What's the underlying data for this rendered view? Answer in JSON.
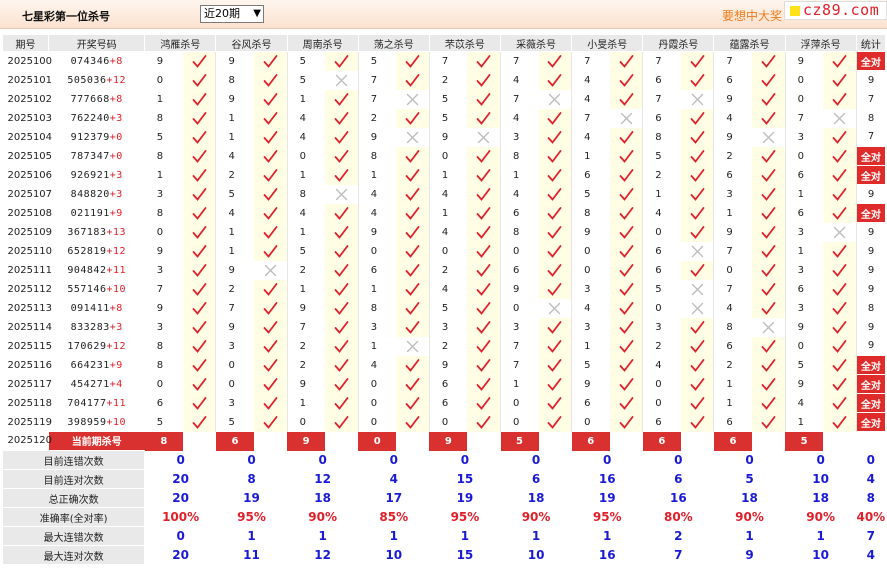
{
  "header": {
    "title": "七星彩第一位杀号",
    "period_select": "近20期",
    "banner": "要想中大奖",
    "site": "cz89.com"
  },
  "columns": [
    "期号",
    "开奖号码",
    "鸿雁杀号",
    "谷风杀号",
    "周南杀号",
    "荡之杀号",
    "芣苡杀号",
    "采薇杀号",
    "小旻杀号",
    "丹霞杀号",
    "蕴露杀号",
    "浮萍杀号",
    "统计"
  ],
  "rows": [
    {
      "period": "2025100",
      "draw": "074346",
      "plus": "+8",
      "kills": [
        9,
        9,
        5,
        5,
        7,
        7,
        7,
        7,
        7,
        9
      ],
      "ok": [
        1,
        1,
        1,
        1,
        1,
        1,
        1,
        1,
        1,
        1
      ],
      "stat": "全对"
    },
    {
      "period": "2025101",
      "draw": "505036",
      "plus": "+12",
      "kills": [
        0,
        8,
        5,
        7,
        2,
        4,
        4,
        6,
        6,
        0
      ],
      "ok": [
        1,
        1,
        0,
        1,
        1,
        1,
        1,
        1,
        1,
        1
      ],
      "stat": "9"
    },
    {
      "period": "2025102",
      "draw": "777668",
      "plus": "+8",
      "kills": [
        1,
        9,
        1,
        7,
        5,
        7,
        4,
        7,
        9,
        0
      ],
      "ok": [
        1,
        1,
        1,
        0,
        1,
        0,
        1,
        0,
        1,
        1
      ],
      "stat": "7"
    },
    {
      "period": "2025103",
      "draw": "762240",
      "plus": "+3",
      "kills": [
        8,
        1,
        4,
        2,
        5,
        4,
        7,
        6,
        4,
        7
      ],
      "ok": [
        1,
        1,
        1,
        1,
        1,
        1,
        0,
        1,
        1,
        0
      ],
      "stat": "8"
    },
    {
      "period": "2025104",
      "draw": "912379",
      "plus": "+0",
      "kills": [
        5,
        1,
        4,
        9,
        9,
        3,
        4,
        8,
        9,
        3
      ],
      "ok": [
        1,
        1,
        1,
        0,
        0,
        1,
        1,
        1,
        0,
        1
      ],
      "stat": "7"
    },
    {
      "period": "2025105",
      "draw": "787347",
      "plus": "+0",
      "kills": [
        8,
        4,
        0,
        8,
        0,
        8,
        1,
        5,
        2,
        0
      ],
      "ok": [
        1,
        1,
        1,
        1,
        1,
        1,
        1,
        1,
        1,
        1
      ],
      "stat": "全对"
    },
    {
      "period": "2025106",
      "draw": "926921",
      "plus": "+3",
      "kills": [
        1,
        2,
        1,
        1,
        1,
        1,
        6,
        2,
        6,
        6
      ],
      "ok": [
        1,
        1,
        1,
        1,
        1,
        1,
        1,
        1,
        1,
        1
      ],
      "stat": "全对"
    },
    {
      "period": "2025107",
      "draw": "848820",
      "plus": "+3",
      "kills": [
        3,
        5,
        8,
        4,
        4,
        4,
        5,
        1,
        3,
        1
      ],
      "ok": [
        1,
        1,
        0,
        1,
        1,
        1,
        1,
        1,
        1,
        1
      ],
      "stat": "9"
    },
    {
      "period": "2025108",
      "draw": "021191",
      "plus": "+9",
      "kills": [
        8,
        4,
        4,
        4,
        1,
        6,
        8,
        4,
        1,
        6
      ],
      "ok": [
        1,
        1,
        1,
        1,
        1,
        1,
        1,
        1,
        1,
        1
      ],
      "stat": "全对"
    },
    {
      "period": "2025109",
      "draw": "367183",
      "plus": "+13",
      "kills": [
        0,
        1,
        1,
        9,
        4,
        8,
        9,
        0,
        9,
        3
      ],
      "ok": [
        1,
        1,
        1,
        1,
        1,
        1,
        1,
        1,
        1,
        0
      ],
      "stat": "9"
    },
    {
      "period": "2025110",
      "draw": "652819",
      "plus": "+12",
      "kills": [
        9,
        1,
        5,
        0,
        0,
        0,
        0,
        6,
        7,
        1
      ],
      "ok": [
        1,
        1,
        1,
        1,
        1,
        1,
        1,
        0,
        1,
        1
      ],
      "stat": "9"
    },
    {
      "period": "2025111",
      "draw": "904842",
      "plus": "+11",
      "kills": [
        3,
        9,
        2,
        6,
        2,
        6,
        0,
        6,
        0,
        3
      ],
      "ok": [
        1,
        0,
        1,
        1,
        1,
        1,
        1,
        1,
        1,
        1
      ],
      "stat": "9"
    },
    {
      "period": "2025112",
      "draw": "557146",
      "plus": "+10",
      "kills": [
        7,
        2,
        1,
        1,
        4,
        9,
        3,
        5,
        7,
        6
      ],
      "ok": [
        1,
        1,
        1,
        1,
        1,
        1,
        1,
        0,
        1,
        1
      ],
      "stat": "9"
    },
    {
      "period": "2025113",
      "draw": "091411",
      "plus": "+8",
      "kills": [
        9,
        7,
        9,
        8,
        5,
        0,
        4,
        0,
        4,
        3
      ],
      "ok": [
        1,
        1,
        1,
        1,
        1,
        0,
        1,
        0,
        1,
        1
      ],
      "stat": "8"
    },
    {
      "period": "2025114",
      "draw": "833283",
      "plus": "+3",
      "kills": [
        3,
        9,
        7,
        3,
        3,
        3,
        3,
        3,
        8,
        9
      ],
      "ok": [
        1,
        1,
        1,
        1,
        1,
        1,
        1,
        1,
        0,
        1
      ],
      "stat": "9"
    },
    {
      "period": "2025115",
      "draw": "170629",
      "plus": "+12",
      "kills": [
        8,
        3,
        2,
        1,
        2,
        7,
        1,
        2,
        6,
        0
      ],
      "ok": [
        1,
        1,
        1,
        0,
        1,
        1,
        1,
        1,
        1,
        1
      ],
      "stat": "9"
    },
    {
      "period": "2025116",
      "draw": "664231",
      "plus": "+9",
      "kills": [
        8,
        0,
        2,
        4,
        9,
        7,
        5,
        4,
        2,
        5
      ],
      "ok": [
        1,
        1,
        1,
        1,
        1,
        1,
        1,
        1,
        1,
        1
      ],
      "stat": "全对"
    },
    {
      "period": "2025117",
      "draw": "454271",
      "plus": "+4",
      "kills": [
        0,
        0,
        9,
        0,
        6,
        1,
        9,
        0,
        1,
        9
      ],
      "ok": [
        1,
        1,
        1,
        1,
        1,
        1,
        1,
        1,
        1,
        1
      ],
      "stat": "全对"
    },
    {
      "period": "2025118",
      "draw": "704177",
      "plus": "+11",
      "kills": [
        6,
        3,
        1,
        0,
        6,
        0,
        6,
        0,
        1,
        4
      ],
      "ok": [
        1,
        1,
        1,
        1,
        1,
        1,
        1,
        1,
        1,
        1
      ],
      "stat": "全对"
    },
    {
      "period": "2025119",
      "draw": "398959",
      "plus": "+10",
      "kills": [
        5,
        5,
        0,
        0,
        0,
        0,
        0,
        6,
        6,
        1
      ],
      "ok": [
        1,
        1,
        1,
        1,
        1,
        1,
        1,
        1,
        1,
        1
      ],
      "stat": "全对"
    }
  ],
  "current": {
    "period": "2025120",
    "label": "当前期杀号",
    "kills": [
      "8",
      "6",
      "9",
      "0",
      "9",
      "5",
      "6",
      "6",
      "6",
      "5"
    ]
  },
  "summary": [
    {
      "label": "目前连错次数",
      "values": [
        "0",
        "0",
        "0",
        "0",
        "0",
        "0",
        "0",
        "0",
        "0",
        "0",
        "0"
      ],
      "pct": false
    },
    {
      "label": "目前连对次数",
      "values": [
        "20",
        "8",
        "12",
        "4",
        "15",
        "6",
        "16",
        "6",
        "5",
        "10",
        "4"
      ],
      "pct": false
    },
    {
      "label": "总正确次数",
      "values": [
        "20",
        "19",
        "18",
        "17",
        "19",
        "18",
        "19",
        "16",
        "18",
        "18",
        "8"
      ],
      "pct": false
    },
    {
      "label": "准确率(全对率)",
      "values": [
        "100%",
        "95%",
        "90%",
        "85%",
        "95%",
        "90%",
        "95%",
        "80%",
        "90%",
        "90%",
        "40%"
      ],
      "pct": true
    },
    {
      "label": "最大连错次数",
      "values": [
        "0",
        "1",
        "1",
        "1",
        "1",
        "1",
        "1",
        "2",
        "1",
        "1",
        "7"
      ],
      "pct": false
    },
    {
      "label": "最大连对次数",
      "values": [
        "20",
        "11",
        "12",
        "10",
        "15",
        "10",
        "16",
        "7",
        "9",
        "10",
        "4"
      ],
      "pct": false
    }
  ],
  "colors": {
    "accent_red": "#e02b2b",
    "check": "#e0202a",
    "cross": "#bcbcbc",
    "summary_blue": "#1a1ad6",
    "banner_orange": "#f07a1a"
  },
  "icons": {
    "ok": "check-icon",
    "bad": "cross-icon"
  }
}
